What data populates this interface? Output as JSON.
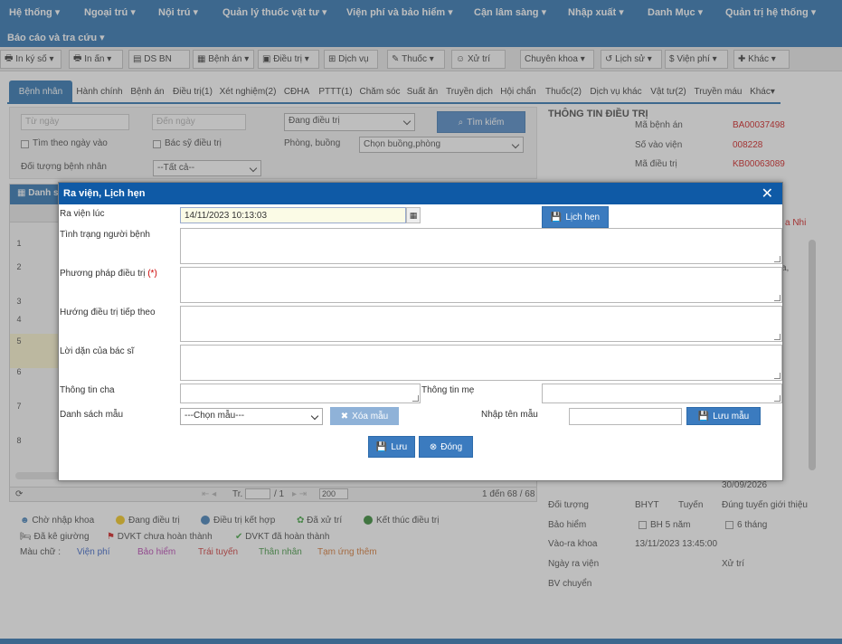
{
  "nav": {
    "row1": [
      "Hệ thống",
      "Ngoại trú",
      "Nội trú",
      "Quản lý thuốc vật tư",
      "Viện phí và bảo hiểm",
      "Cận lâm sàng",
      "Nhập xuất",
      "Danh Mục",
      "Quản trị hệ thống"
    ],
    "row2": [
      "Báo cáo và tra cứu"
    ]
  },
  "toolbar": [
    "In ký số",
    "In ấn",
    "DS BN",
    "Bệnh án",
    "Điều trị",
    "Dịch vụ",
    "Thuốc",
    "Xử trí",
    "Chuyên khoa",
    "Lịch sử",
    "Viện phí",
    "Khác"
  ],
  "tabs": [
    "Bệnh nhân",
    "Hành chính",
    "Bệnh án",
    "Điều trị(1)",
    "Xét nghiệm(2)",
    "CĐHA",
    "PTTT(1)",
    "Chăm sóc",
    "Suất ăn",
    "Truyền dịch",
    "Hội chẩn",
    "Thuốc(2)",
    "Dịch vụ khác",
    "Vật tư(2)",
    "Truyền máu",
    "Khác"
  ],
  "filter": {
    "from_placeholder": "Từ ngày",
    "to_placeholder": "Đến ngày",
    "status_value": "Đang điều trị",
    "search_label": "Tìm kiếm",
    "by_date_label": "Tìm theo ngày vào",
    "doctor_label": "Bác sỹ điều trị",
    "room_label": "Phòng, buồng",
    "room_value": "Chọn buồng,phòng",
    "patient_type_label": "Đối tượng bệnh nhân",
    "patient_type_value": "--Tất cả--"
  },
  "grid": {
    "title": "Danh s",
    "rows": [
      "1",
      "2",
      "3",
      "4",
      "5",
      "6",
      "7",
      "8"
    ],
    "pager_label": "Tr.",
    "pager_total": "/ 1",
    "page_size": "200",
    "count_text": "1 đến 68 / 68"
  },
  "legend": {
    "waiting": "Chờ nhập khoa",
    "treating": "Đang điều trị",
    "combined": "Điều trị kết hợp",
    "processed": "Đã xử trí",
    "finished": "Kết thúc điều trị",
    "bed": "Đã kê giường",
    "dvkt_pending": "DVKT chưa hoàn thành",
    "dvkt_done": "DVKT đã hoàn thành",
    "color_label": "Màu chữ :",
    "fee": "Viện phí",
    "insurance": "Bảo hiểm",
    "off_route": "Trái tuyến",
    "relatives": "Thân nhân",
    "advance": "Tạm ứng thêm"
  },
  "info": {
    "title": "THÔNG TIN ĐIỀU TRỊ",
    "record_label": "Mã bệnh án",
    "record_value": "BA00037498",
    "admission_label": "Số vào viện",
    "admission_value": "008228",
    "treatment_label": "Mã điều trị",
    "treatment_value": "KB00063089",
    "tab_fragment": "a Nhi",
    "frag1": "a,",
    "date_value": "30/09/2026",
    "subject_label": "Đối tượng",
    "subject_value": "BHYT",
    "route_value": "Tuyến",
    "route_detail": "Đúng tuyến giới thiệu",
    "insurance_label": "Bảo hiểm",
    "bh5_label": "BH 5 năm",
    "six_months_label": "6 tháng",
    "in_out_label": "Vào-ra khoa",
    "in_out_value": "13/11/2023 13:45:00",
    "discharge_date_label": "Ngày ra viện",
    "handled_label": "Xử trí",
    "transfer_label": "BV chuyển"
  },
  "modal": {
    "title": "Ra viện, Lịch hẹn",
    "discharge_at_label": "Ra viện lúc",
    "discharge_at_value": "14/11/2023 10:13:03",
    "appointment_button": "Lịch hẹn",
    "condition_label": "Tình trạng người bệnh",
    "method_label": "Phương pháp điều trị",
    "required_mark": "(*)",
    "next_direction_label": "Hướng điều trị tiếp theo",
    "advice_label": "Lời dặn của bác sĩ",
    "father_label": "Thông tin cha",
    "mother_label": "Thông tin mẹ",
    "template_list_label": "Danh sách mẫu",
    "template_select_value": "---Chọn mẫu---",
    "delete_template_button": "Xóa mẫu",
    "template_name_label": "Nhập tên mẫu",
    "save_template_button": "Lưu mẫu",
    "save_button": "Lưu",
    "close_button": "Đóng"
  },
  "colors": {
    "nav": "#1463a8",
    "modal_header": "#0f5aa6",
    "button": "#3b7bbf",
    "red": "#cc0000"
  }
}
